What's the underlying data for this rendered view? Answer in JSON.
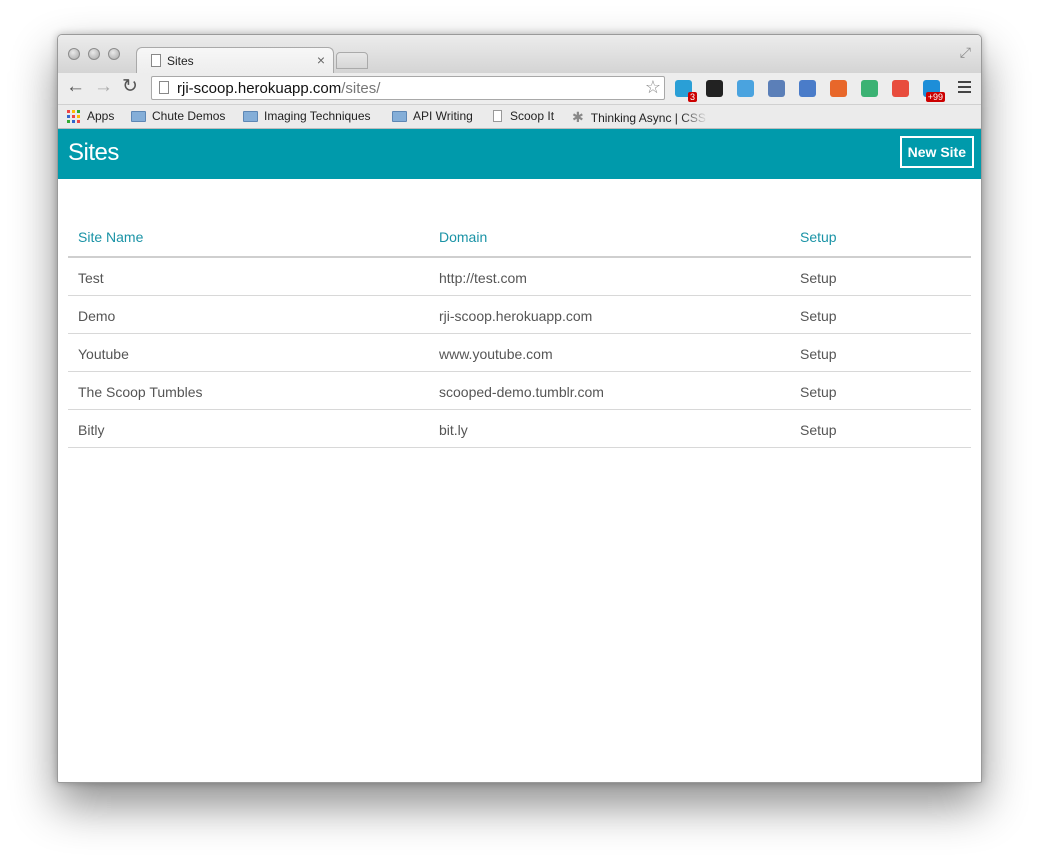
{
  "browser": {
    "tab_title": "Sites",
    "tab_close": "×",
    "url_host": "rji-scoop.herokuapp.com",
    "url_path": "/sites/",
    "back": "←",
    "forward": "→",
    "reload": "↻",
    "star": "☆",
    "fullscreen": "⤢",
    "extensions": [
      {
        "name": "task-extension",
        "color": "#2a9fd6",
        "badge": "3"
      },
      {
        "name": "buffer-extension",
        "color": "#222222",
        "badge": ""
      },
      {
        "name": "phone-extension",
        "color": "#4aa3df",
        "badge": ""
      },
      {
        "name": "window-extension",
        "color": "#5b7fb8",
        "badge": ""
      },
      {
        "name": "notes-extension",
        "color": "#4a7cc9",
        "badge": ""
      },
      {
        "name": "fire-extension",
        "color": "#e8672a",
        "badge": ""
      },
      {
        "name": "pushbullet-extension",
        "color": "#3bb273",
        "badge": ""
      },
      {
        "name": "timer-extension",
        "color": "#e84c3d",
        "badge": ""
      },
      {
        "name": "plus-extension",
        "color": "#1d8ed8",
        "badge": "+99"
      }
    ]
  },
  "bookmarks": [
    {
      "label": "Apps",
      "icon": "apps-grid-icon"
    },
    {
      "label": "Chute Demos",
      "icon": "folder-icon"
    },
    {
      "label": "Imaging Techniques",
      "icon": "folder-icon"
    },
    {
      "label": "API Writing",
      "icon": "folder-icon"
    },
    {
      "label": "Scoop It",
      "icon": "page-icon"
    },
    {
      "label": "Thinking Async | CSS",
      "icon": "asterisk-icon"
    }
  ],
  "header": {
    "title": "Sites",
    "new_site_label": "New Site",
    "color": "#009aab"
  },
  "table": {
    "columns": [
      "Site Name",
      "Domain",
      "Setup"
    ],
    "rows": [
      {
        "name": "Test",
        "domain": "http://test.com",
        "setup": "Setup"
      },
      {
        "name": "Demo",
        "domain": "rji-scoop.herokuapp.com",
        "setup": "Setup"
      },
      {
        "name": "Youtube",
        "domain": "www.youtube.com",
        "setup": "Setup"
      },
      {
        "name": "The Scoop Tumbles",
        "domain": "scooped-demo.tumblr.com",
        "setup": "Setup"
      },
      {
        "name": "Bitly",
        "domain": "bit.ly",
        "setup": "Setup"
      }
    ]
  }
}
